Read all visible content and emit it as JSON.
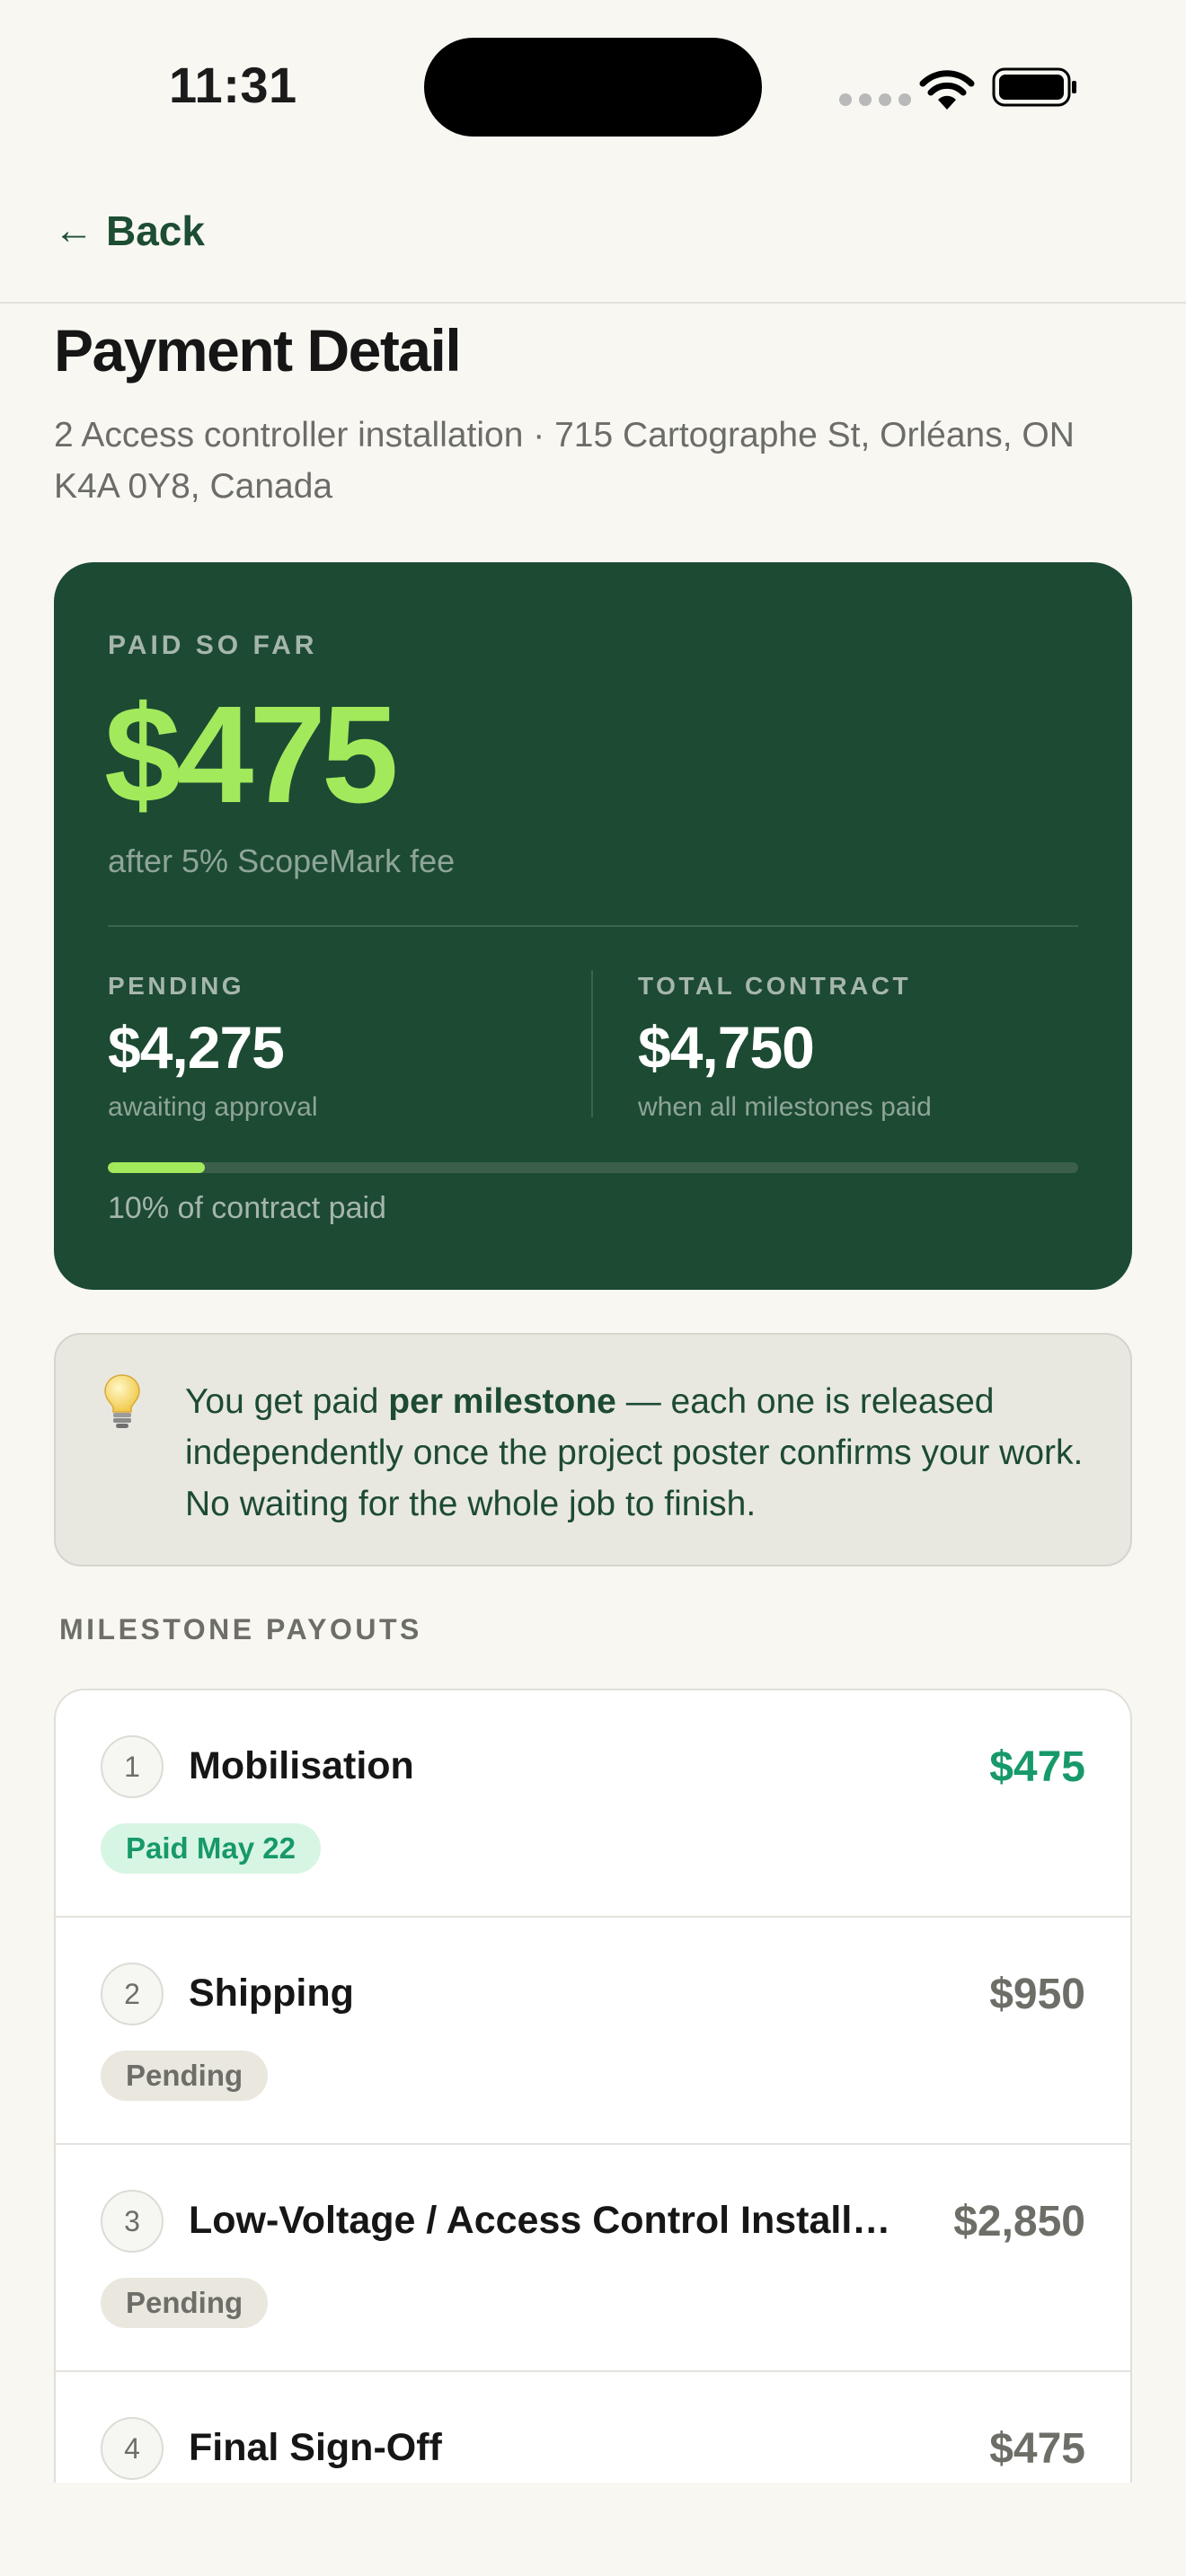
{
  "status_bar": {
    "time": "11:31"
  },
  "nav": {
    "back_arrow": "←",
    "back_label": "Back"
  },
  "header": {
    "title": "Payment Detail",
    "subtitle": "2 Access controller installation  · 715 Cartographe St, Orléans, ON K4A 0Y8, Canada"
  },
  "summary": {
    "paid_label": "PAID SO FAR",
    "paid_amount": "$475",
    "fee_note": "after 5% ScopeMark fee",
    "pending": {
      "label": "PENDING",
      "value": "$4,275",
      "caption": "awaiting approval"
    },
    "total": {
      "label": "TOTAL CONTRACT",
      "value": "$4,750",
      "caption": "when all milestones paid"
    },
    "progress_fraction": 0.1,
    "progress_label": "10% of contract paid",
    "colors": {
      "card_bg": "#1c4a33",
      "accent": "#a3e95c"
    }
  },
  "info": {
    "icon": "lightbulb-icon",
    "text_before": "You get paid ",
    "text_bold": "per milestone",
    "text_after": " — each one is released independently once the project poster confirms your work. No waiting for the whole job to finish."
  },
  "milestones": {
    "section_title": "MILESTONE PAYOUTS",
    "items": [
      {
        "number": "1",
        "name": "Mobilisation",
        "amount": "$475",
        "status": "Paid May 22",
        "status_type": "paid"
      },
      {
        "number": "2",
        "name": "Shipping",
        "amount": "$950",
        "status": "Pending",
        "status_type": "pending"
      },
      {
        "number": "3",
        "name": "Low-Voltage / Access Control Installation",
        "amount": "$2,850",
        "status": "Pending",
        "status_type": "pending"
      },
      {
        "number": "4",
        "name": "Final Sign-Off",
        "amount": "$475",
        "status": "",
        "status_type": "pending"
      }
    ],
    "colors": {
      "paid": "#17996a",
      "pending": "#6e6e68"
    }
  }
}
